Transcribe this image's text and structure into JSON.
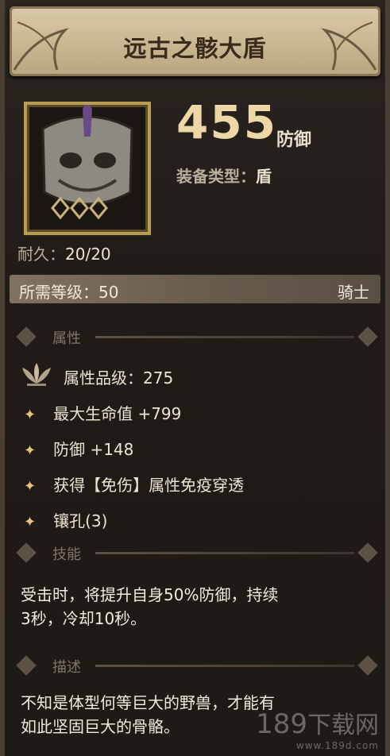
{
  "item": {
    "name": "远古之骸大盾",
    "defense_value": "455",
    "defense_unit": "防御",
    "type_label": "装备类型：",
    "type_value": "盾",
    "durability_label": "耐久：",
    "durability_value": "20/20",
    "level_label": "所需等级：50",
    "class": "骑士"
  },
  "sections": {
    "attributes": "属性",
    "skill": "技能",
    "description": "描述"
  },
  "attributes": {
    "grade": "属性品级：275",
    "lines": [
      "最大生命值 +799",
      "防御 +148",
      "获得【免伤】属性免疫穿透",
      "镶孔(3)"
    ]
  },
  "skill_text": {
    "line1": "受击时，将提升自身50%防御，持续",
    "line2": "3秒，冷却10秒。"
  },
  "description_text": {
    "line1": "不知是体型何等巨大的野兽，才能有",
    "line2": "如此坚固巨大的骨骼。"
  },
  "watermark": {
    "num": "189",
    "text": "下载网",
    "url": "www.189d.com"
  },
  "colors": {
    "title_text": "#3a2a1c",
    "defense_value": "#efd6a6",
    "gem_star": "#e9c27f",
    "frame_gold": "#b79c52"
  }
}
